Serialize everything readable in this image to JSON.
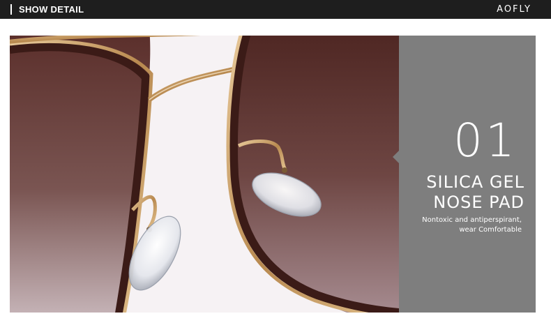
{
  "header": {
    "section_title": "SHOW DETAIL",
    "brand": "AOFLY"
  },
  "feature": {
    "number": "01",
    "title_line1": "SILICA GEL",
    "title_line2": "NOSE PAD",
    "description_line1": "Nontoxic and antiperspirant,",
    "description_line2": "wear Comfortable"
  },
  "colors": {
    "header_bg": "#1e1e1e",
    "panel_bg": "#7e7e7e",
    "lens_tint": "#5a2f2a",
    "frame_gold": "#c9a06b"
  }
}
